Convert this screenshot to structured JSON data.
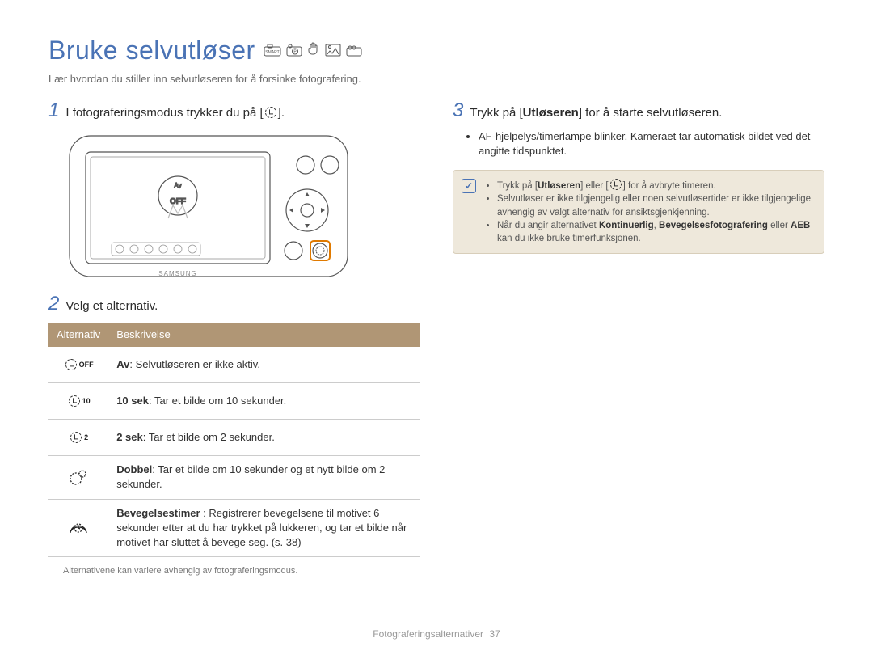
{
  "title": "Bruke selvutløser",
  "subtitle": "Lær hvordan du stiller inn selvutløseren for å forsinke fotografering.",
  "steps": {
    "1": {
      "num": "1",
      "text_a": "I fotograferingsmodus trykker du på [",
      "text_b": "]."
    },
    "2": {
      "num": "2",
      "text": "Velg et alternativ."
    },
    "3": {
      "num": "3",
      "text_a": "Trykk på [",
      "text_bold": "Utløseren",
      "text_b": "] for å starte selvutløseren.",
      "bullet": "AF-hjelpelys/timerlampe blinker. Kameraet tar automatisk bildet ved det angitte tidspunktet."
    }
  },
  "camera": {
    "brand": "SAMSUNG",
    "screen_mode": "Av",
    "screen_state": "OFF"
  },
  "table": {
    "headers": {
      "alt": "Alternativ",
      "desc": "Beskrivelse"
    },
    "rows": [
      {
        "icon_sub": "OFF",
        "bold": "Av",
        "desc": ": Selvutløseren er ikke aktiv."
      },
      {
        "icon_sub": "10",
        "bold": "10 sek",
        "desc": ": Tar et bilde om 10 sekunder."
      },
      {
        "icon_sub": "2",
        "bold": "2 sek",
        "desc": ": Tar et bilde om 2 sekunder."
      },
      {
        "icon_variant": "double",
        "bold": "Dobbel",
        "desc": ": Tar et bilde om 10 sekunder og et nytt bilde om 2 sekunder."
      },
      {
        "icon_variant": "motion",
        "bold": "Bevegelsestimer",
        "desc": " : Registrerer bevegelsene til motivet 6 sekunder etter at du har trykket på lukkeren, og tar et bilde når motivet har sluttet å bevege seg. (s. 38)"
      }
    ]
  },
  "footnote": "Alternativene kan variere avhengig av fotograferingsmodus.",
  "note": {
    "items": [
      {
        "pre": "Trykk på [",
        "bold1": "Utløseren",
        "mid": "] eller [",
        "post": "] for å avbryte timeren."
      },
      {
        "text": "Selvutløser er ikke tilgjengelig eller noen selvutløsertider er ikke tilgjengelige avhengig av valgt alternativ for ansiktsgjenkjenning."
      },
      {
        "pre": "Når du angir alternativet ",
        "bold1": "Kontinuerlig",
        "sep": ", ",
        "bold2": "Bevegelsesfotografering",
        "mid2": " eller ",
        "bold3": "AEB",
        "post": " kan du ikke bruke timerfunksjonen."
      }
    ]
  },
  "footer": {
    "section": "Fotograferingsalternativer",
    "page": "37"
  }
}
